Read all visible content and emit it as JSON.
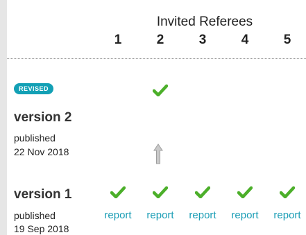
{
  "header": {
    "title": "Invited Referees"
  },
  "referees": [
    "1",
    "2",
    "3",
    "4",
    "5"
  ],
  "versions": [
    {
      "badge": "REVISED",
      "title": "version 2",
      "published_label": "published",
      "date": "22 Nov 2018"
    },
    {
      "title": "version 1",
      "published_label": "published",
      "date": "19 Sep 2018"
    }
  ],
  "reports": [
    "report",
    "report",
    "report",
    "report",
    "report"
  ],
  "colors": {
    "accent": "#13a0b5",
    "check": "#4caf2a",
    "link": "#1a9db5",
    "arrow": "#bdbdbd"
  },
  "icons": {
    "approved": "check-icon",
    "revision_link": "arrow-up-icon"
  }
}
